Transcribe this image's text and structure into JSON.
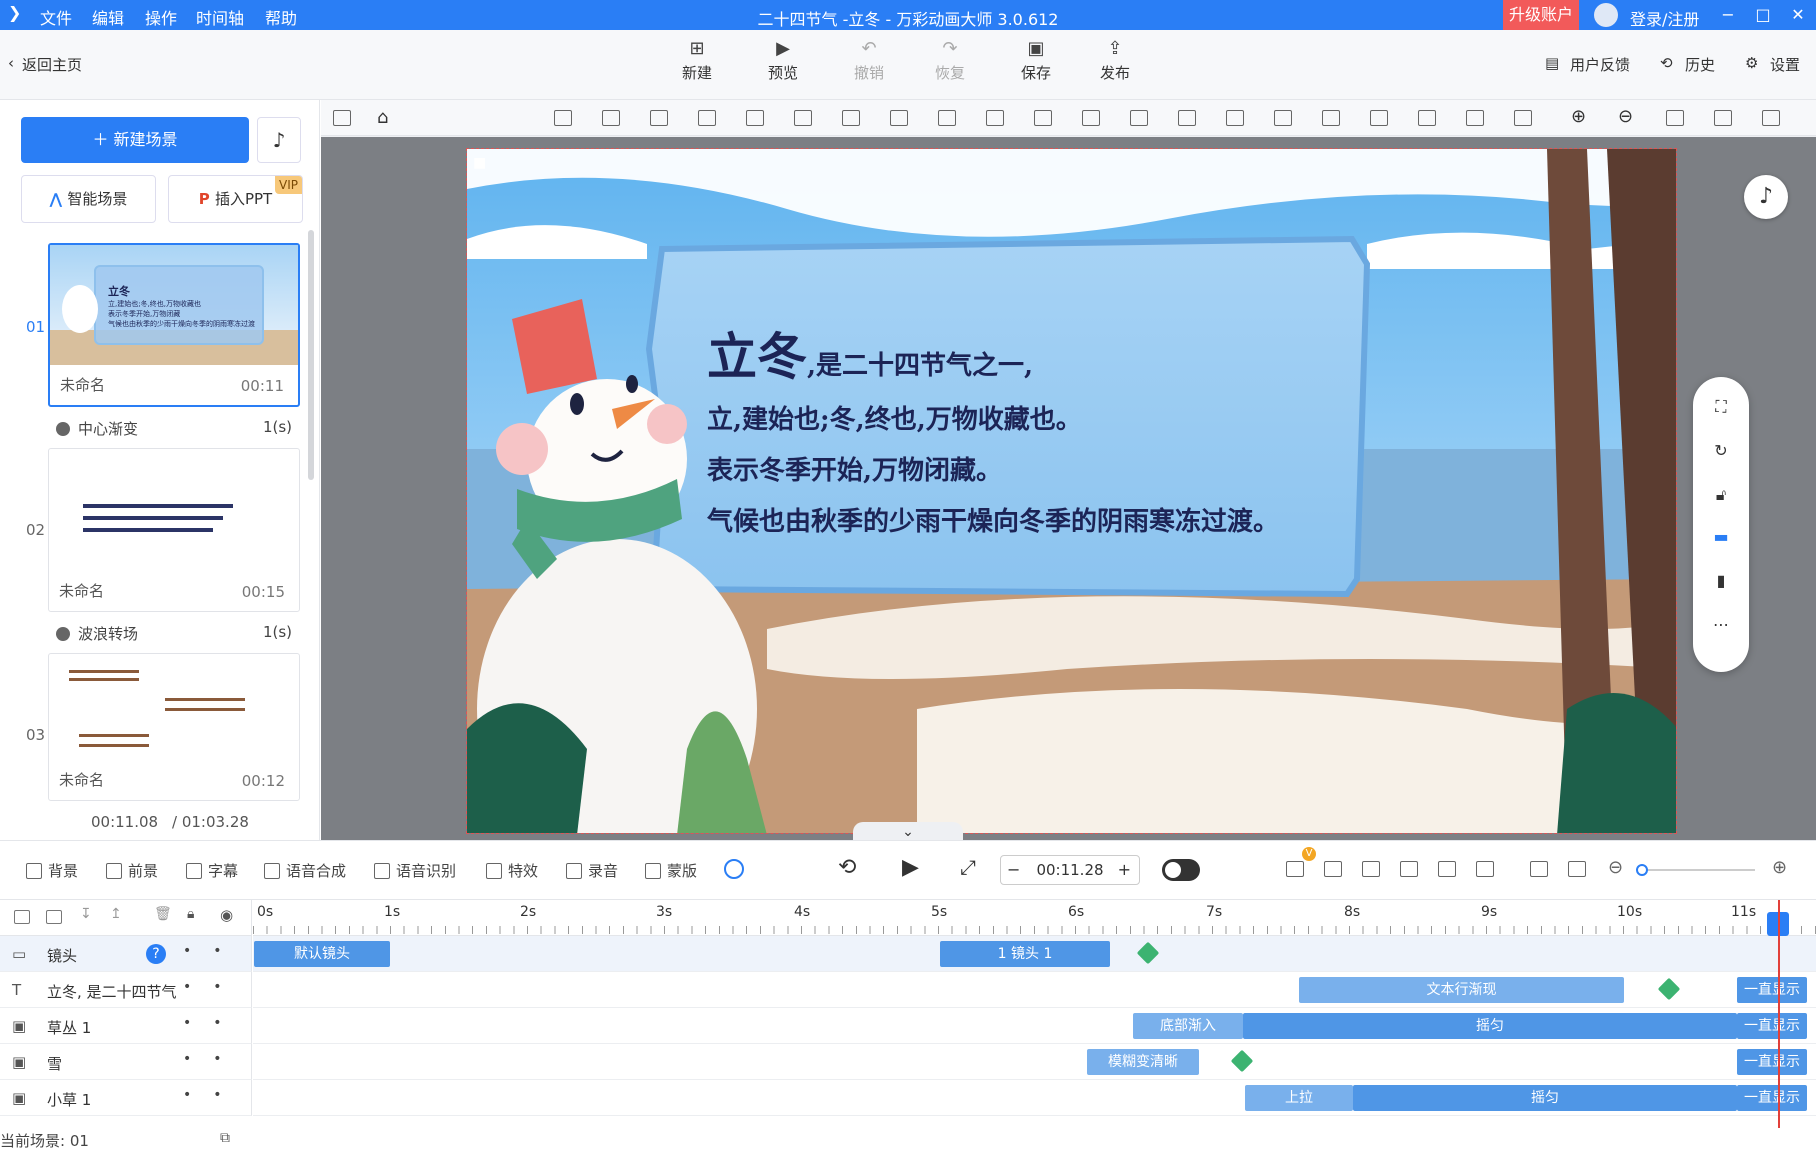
{
  "titlebar": {
    "menu": [
      "文件",
      "编辑",
      "操作",
      "时间轴",
      "帮助"
    ],
    "title": "二十四节气 -立冬 - 万彩动画大师 3.0.612",
    "upgrade": "升级账户",
    "login": "登录/注册",
    "win": [
      "−",
      "□",
      "✕"
    ]
  },
  "toolbar": {
    "back": "返回主页",
    "buttons": [
      {
        "label": "新建",
        "icon": "plus-square-icon"
      },
      {
        "label": "预览",
        "icon": "play-icon"
      },
      {
        "label": "撤销",
        "icon": "undo-icon"
      },
      {
        "label": "恢复",
        "icon": "redo-icon"
      },
      {
        "label": "保存",
        "icon": "save-icon"
      },
      {
        "label": "发布",
        "icon": "publish-icon"
      }
    ],
    "right": [
      "用户反馈",
      "历史",
      "设置"
    ]
  },
  "left": {
    "new_scene": "新建场景",
    "smart_scene": "智能场景",
    "insert_ppt": "插入PPT",
    "vip": "VIP",
    "scenes": [
      {
        "num": "01",
        "name": "未命名",
        "dur": "00:11",
        "preview_title": "立冬",
        "preview_lines": [
          "立,建始也;冬,终也,万物收藏也",
          "表示冬季开始,万物闭藏",
          "气候也由秋季的少雨干燥向冬季的阴雨寒冻过渡"
        ]
      },
      {
        "num": "02",
        "name": "未命名",
        "dur": "00:15"
      },
      {
        "num": "03",
        "name": "未命名",
        "dur": "00:12"
      }
    ],
    "transitions": [
      {
        "name": "中心渐变",
        "dur": "1(s)"
      },
      {
        "name": "波浪转场",
        "dur": "1(s)"
      }
    ],
    "current_time": "00:11.08",
    "total_time": "/ 01:03.28"
  },
  "scene": {
    "big": "立冬",
    "line1_tail": ",是二十四节气之一,",
    "line2": "立,建始也;冬,终也,万物收藏也。",
    "line3": "表示冬季开始,万物闭藏。",
    "line4": "气候也由秋季的少雨干燥向冬季的阴雨寒冻过渡。"
  },
  "bottombar": {
    "items": [
      "背景",
      "前景",
      "字幕",
      "语音合成",
      "语音识别",
      "特效",
      "录音",
      "蒙版"
    ],
    "time": "00:11.28",
    "minus": "−",
    "plus": "+",
    "vbadge": "V"
  },
  "timeline": {
    "ticks": [
      "0s",
      "1s",
      "2s",
      "3s",
      "4s",
      "5s",
      "6s",
      "7s",
      "8s",
      "9s",
      "10s",
      "11s"
    ],
    "tracks": [
      {
        "name": "镜头",
        "clips": [
          "默认镜头",
          "1 镜头 1"
        ]
      },
      {
        "name": "立冬, 是二十四节气",
        "clips": [
          "文本行渐现",
          "一直显示"
        ]
      },
      {
        "name": "草丛 1",
        "clips": [
          "底部渐入",
          "摇匀",
          "一直显示"
        ]
      },
      {
        "name": "雪",
        "clips": [
          "模糊变清晰",
          "一直显示"
        ]
      },
      {
        "name": "小草 1",
        "clips": [
          "上拉",
          "摇匀",
          "一直显示"
        ]
      }
    ],
    "current_scene": "当前场景: 01"
  },
  "colors": {
    "accent": "#2a7ef5",
    "clip": "#4f96e6",
    "upgrade": "#f25a5a",
    "keyframe": "#3cb371"
  }
}
